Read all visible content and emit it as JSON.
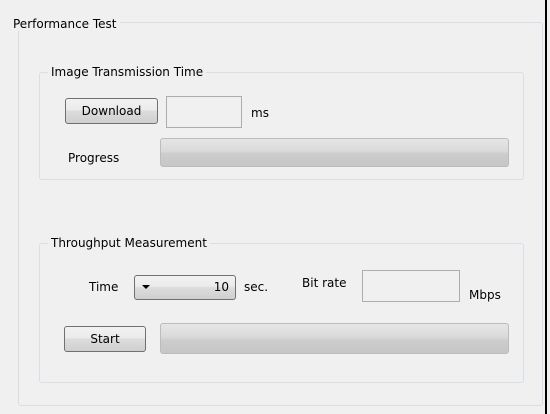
{
  "performance_test": {
    "title": "Performance Test",
    "image_transmission": {
      "title": "Image Transmission Time",
      "download_button": "Download",
      "time_value": "",
      "time_unit": "ms",
      "progress_label": "Progress",
      "progress_value": 0
    },
    "throughput": {
      "title": "Throughput Measurement",
      "time_label": "Time",
      "time_value": "10",
      "time_unit": "sec.",
      "bitrate_label": "Bit rate",
      "bitrate_value": "",
      "bitrate_unit": "Mbps",
      "start_button": "Start",
      "progress_value": 0
    }
  }
}
